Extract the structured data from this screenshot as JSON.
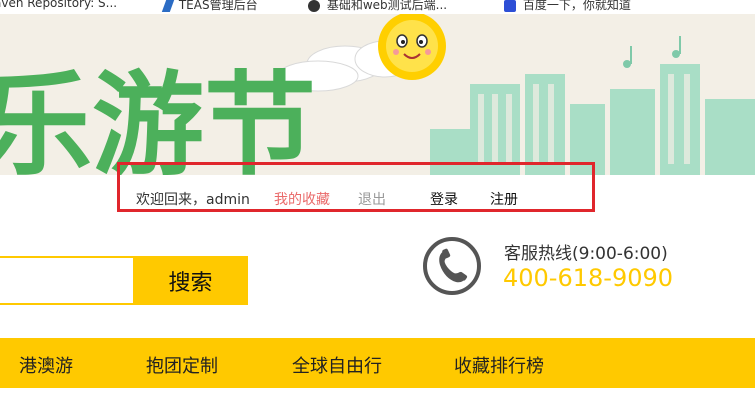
{
  "bookmarks": [
    {
      "label": "aven Repository: S..."
    },
    {
      "label": "TEAS管理后台"
    },
    {
      "label": "基础和web测试后端..."
    },
    {
      "label": "百度一下，你就知道"
    }
  ],
  "banner": {
    "text": "乐游节",
    "colors": {
      "text": "#4cb05b",
      "sun": "#ffd400",
      "bg": "#f3efe6",
      "buildings": "#9fd9bf"
    }
  },
  "user_bar": {
    "welcome": "欢迎回来，admin",
    "favorites": "我的收藏",
    "logout": "退出",
    "login": "登录",
    "register": "注册",
    "highlight_color": "#e0262c"
  },
  "search": {
    "placeholder": "",
    "button_label": "搜索"
  },
  "hotline": {
    "label": "客服热线(9:00-6:00)",
    "number": "400-618-9090",
    "icon": "phone-icon"
  },
  "nav": {
    "items": [
      "港澳游",
      "抱团定制",
      "全球自由行",
      "收藏排行榜"
    ],
    "background": "#ffc900"
  }
}
